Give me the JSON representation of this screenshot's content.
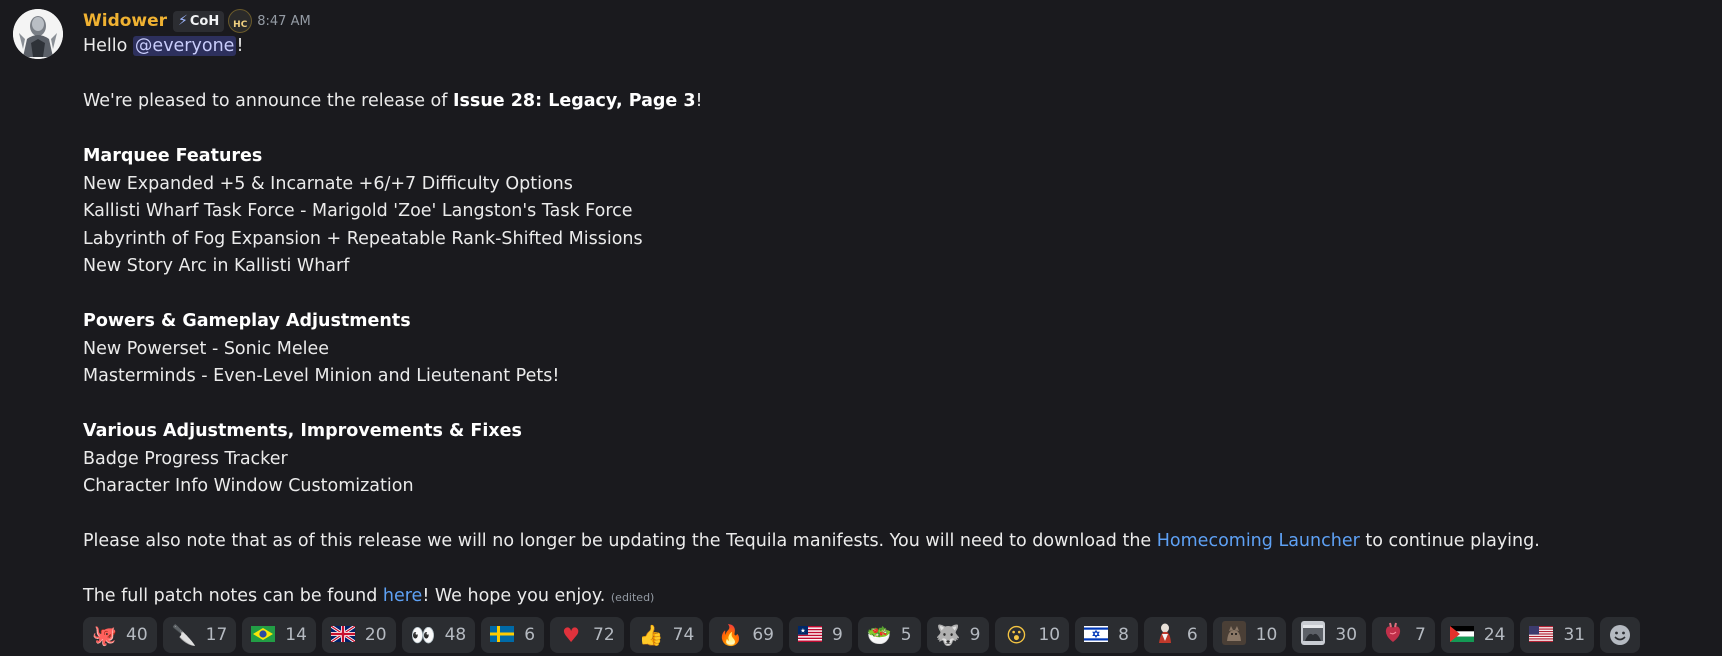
{
  "author": {
    "name": "Widower",
    "tag": "CoH",
    "server_badge": "HC",
    "timestamp": "8:47 AM"
  },
  "message": {
    "greeting_prefix": "Hello ",
    "mention": "@everyone",
    "greeting_suffix": "!",
    "announce_prefix": "We're pleased to announce the release of ",
    "announce_bold": "Issue 28: Legacy, Page 3",
    "announce_suffix": "!",
    "sections": [
      {
        "heading": "Marquee Features",
        "items": [
          "New Expanded +5 & Incarnate +6/+7 Difficulty Options",
          "Kallisti Wharf Task Force - Marigold 'Zoe' Langston's Task Force",
          "Labyrinth of Fog Expansion + Repeatable Rank-Shifted Missions",
          "New Story Arc in Kallisti Wharf"
        ]
      },
      {
        "heading": "Powers & Gameplay Adjustments",
        "items": [
          "New Powerset - Sonic Melee",
          "Masterminds - Even-Level Minion and Lieutenant Pets!"
        ]
      },
      {
        "heading": "Various Adjustments, Improvements & Fixes",
        "items": [
          "Badge Progress Tracker",
          "Character Info Window Customization"
        ]
      }
    ],
    "note_prefix": "Please also note that as of this release we will no longer be updating the Tequila manifests. You will need to download the ",
    "note_link": "Homecoming Launcher",
    "note_suffix": " to continue playing.",
    "final_prefix": "The full patch notes can be found ",
    "final_link": "here",
    "final_suffix": "! We hope you enjoy. ",
    "edited": "(edited)"
  },
  "reactions": [
    {
      "icon": "octopus-emoji",
      "glyph": "🐙",
      "count": "40"
    },
    {
      "icon": "knife-emoji",
      "glyph": "🔪",
      "count": "17"
    },
    {
      "icon": "flag-brazil-emoji",
      "glyph": "",
      "count": "14"
    },
    {
      "icon": "flag-uk-emoji",
      "glyph": "",
      "count": "20"
    },
    {
      "icon": "eyes-emoji",
      "glyph": "👀",
      "count": "48"
    },
    {
      "icon": "flag-sweden-emoji",
      "glyph": "",
      "count": "6"
    },
    {
      "icon": "heart-emoji",
      "glyph": "♥",
      "count": "72"
    },
    {
      "icon": "thumbs-up-emoji",
      "glyph": "👍",
      "count": "74"
    },
    {
      "icon": "fire-emoji",
      "glyph": "🔥",
      "count": "69"
    },
    {
      "icon": "flag-liberia-emoji",
      "glyph": "",
      "count": "9"
    },
    {
      "icon": "salad-emoji",
      "glyph": "🥗",
      "count": "5"
    },
    {
      "icon": "wolf-emoji",
      "glyph": "🐺",
      "count": "9"
    },
    {
      "icon": "yawning-face-emoji",
      "glyph": "😮",
      "count": "10"
    },
    {
      "icon": "flag-israel-emoji",
      "glyph": "",
      "count": "8"
    },
    {
      "icon": "custom-figure-emoji",
      "glyph": "",
      "count": "6"
    },
    {
      "icon": "custom-cat-emoji",
      "glyph": "",
      "count": "10"
    },
    {
      "icon": "custom-photo-emoji",
      "glyph": "",
      "count": "30"
    },
    {
      "icon": "anatomical-heart-emoji",
      "glyph": "",
      "count": "7"
    },
    {
      "icon": "flag-palestine-emoji",
      "glyph": "",
      "count": "24"
    },
    {
      "icon": "flag-usa-emoji",
      "glyph": "",
      "count": "31"
    }
  ],
  "colors": {
    "background": "#1a1a1e",
    "username": "#f0b232",
    "link": "#5ea1f5",
    "mention_bg": "#3a3f74",
    "reaction_bg": "#2b2d31"
  }
}
